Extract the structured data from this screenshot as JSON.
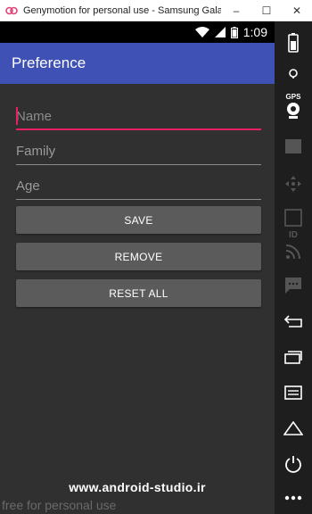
{
  "window": {
    "title": "Genymotion for personal use - Samsung Galaxy S...",
    "minimize": "–",
    "maximize": "☐",
    "close": "✕"
  },
  "status_bar": {
    "time": "1:09"
  },
  "app": {
    "title": "Preference"
  },
  "form": {
    "name_placeholder": "Name",
    "family_placeholder": "Family",
    "age_placeholder": "Age",
    "save_label": "SAVE",
    "remove_label": "REMOVE",
    "reset_label": "RESET ALL"
  },
  "overlay": {
    "website": "www.android-studio.ir",
    "personal_use": "free for personal use"
  },
  "sidebar": {
    "gps_label": "GPS",
    "id_label": "ID",
    "icons": [
      "battery-icon",
      "gps-icon",
      "camera-icon",
      "video-icon",
      "dpad-icon",
      "id-icon",
      "rss-icon",
      "sms-icon",
      "back-icon",
      "recent-apps-icon",
      "menu-icon",
      "home-icon",
      "power-icon",
      "more-icon"
    ]
  },
  "colors": {
    "accent": "#e91e63",
    "primary": "#3f51b5",
    "background": "#303030",
    "button": "#5b5b5b"
  }
}
